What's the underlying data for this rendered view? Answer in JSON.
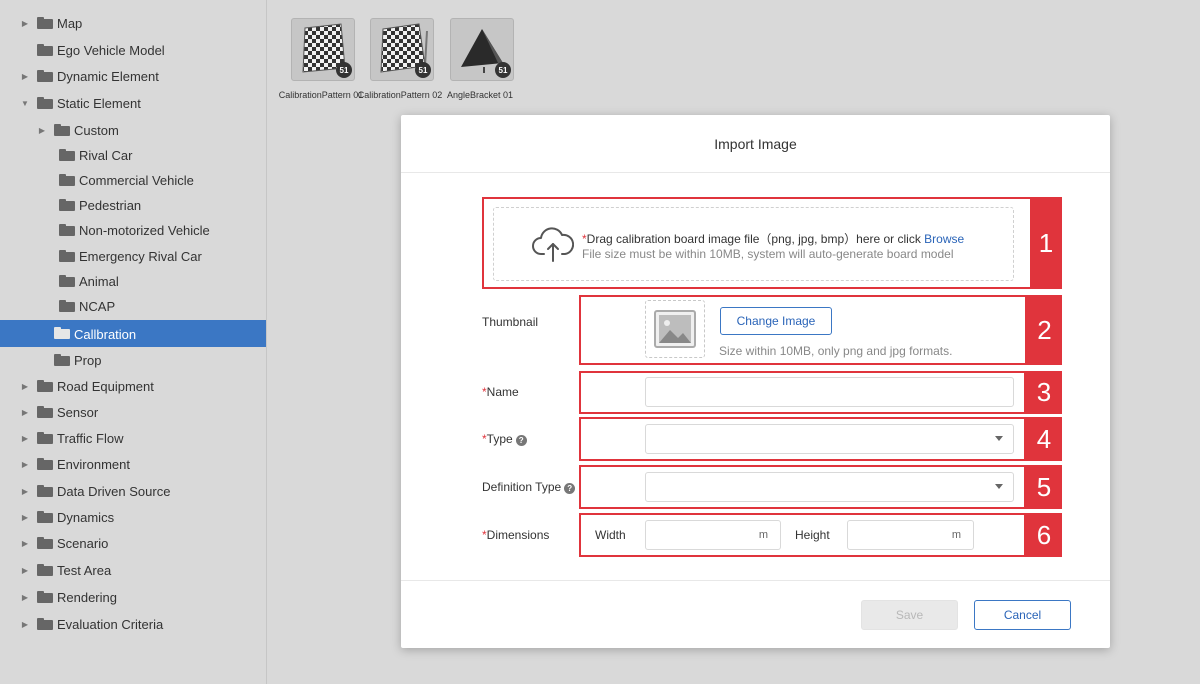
{
  "sidebar": {
    "items": [
      {
        "label": "Map"
      },
      {
        "label": "Ego Vehicle Model"
      },
      {
        "label": "Dynamic Element"
      },
      {
        "label": "Static Element"
      },
      {
        "label": "Custom"
      },
      {
        "label": "Rival Car"
      },
      {
        "label": "Commercial Vehicle"
      },
      {
        "label": "Pedestrian"
      },
      {
        "label": "Non-motorized Vehicle"
      },
      {
        "label": "Emergency Rival Car"
      },
      {
        "label": "Animal"
      },
      {
        "label": "NCAP"
      },
      {
        "label": "Callbration"
      },
      {
        "label": "Prop"
      },
      {
        "label": "Road Equipment"
      },
      {
        "label": "Sensor"
      },
      {
        "label": "Traffic Flow"
      },
      {
        "label": "Environment"
      },
      {
        "label": "Data Driven Source"
      },
      {
        "label": "Dynamics"
      },
      {
        "label": "Scenario"
      },
      {
        "label": "Test Area"
      },
      {
        "label": "Rendering"
      },
      {
        "label": "Evaluation Criteria"
      }
    ],
    "selected": "Callbration"
  },
  "assets": [
    {
      "name": "CalibrationPattern 01",
      "badge": "51",
      "icon": "checkerboard-icon"
    },
    {
      "name": "CalibrationPattern 02",
      "badge": "51",
      "icon": "checkerboard-icon"
    },
    {
      "name": "AngleBracket 01",
      "badge": "51",
      "icon": "angle-bracket-icon"
    }
  ],
  "modal": {
    "title": "Import Image",
    "upload": {
      "required_mark": "*",
      "text": "Drag calibration board image file（png,  jpg,  bmp）here or click ",
      "browse_label": "Browse",
      "hint": "File size must be within 10MB, system will auto-generate board model",
      "icon": "cloud-upload-icon"
    },
    "thumbnail": {
      "label": "Thumbnail",
      "button_label": "Change Image",
      "hint": "Size within 10MB, only png and jpg formats.",
      "icon": "image-placeholder-icon"
    },
    "name": {
      "required_mark": "*",
      "label": "Name",
      "value": ""
    },
    "type": {
      "required_mark": "*",
      "label": "Type",
      "value": "",
      "help_icon": "?"
    },
    "definition_type": {
      "label": "Definition Type",
      "value": "",
      "help_icon": "?"
    },
    "dimensions": {
      "required_mark": "*",
      "label": "Dimensions",
      "width_label": "Width",
      "width_value": "",
      "width_unit": "m",
      "height_label": "Height",
      "height_value": "",
      "height_unit": "m"
    },
    "save_label": "Save",
    "cancel_label": "Cancel"
  },
  "annotations": [
    "1",
    "2",
    "3",
    "4",
    "5",
    "6"
  ],
  "colors": {
    "accent": "#3b77c4",
    "highlight_red": "#e0343c",
    "sidebar_bg": "#d9d9d9",
    "selected_bg": "#3b77c4"
  }
}
